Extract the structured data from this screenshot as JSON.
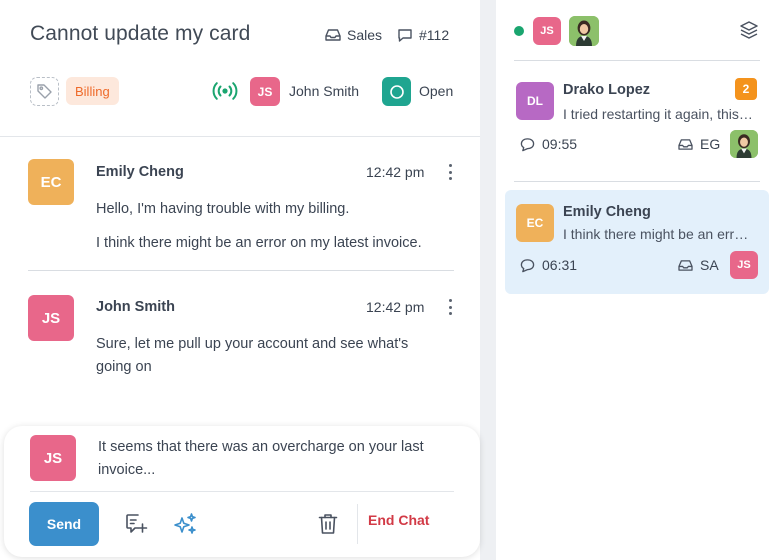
{
  "ticket": {
    "title": "Cannot update my card",
    "department": "Sales",
    "id": "#112",
    "tags": [
      "Billing"
    ],
    "assignee": {
      "initials": "JS",
      "name": "John Smith"
    },
    "status": "Open"
  },
  "messages": [
    {
      "initials": "EC",
      "author": "Emily Cheng",
      "time": "12:42 pm",
      "lines": [
        "Hello, I'm having trouble with my billing.",
        "I think there might be an error on my latest invoice."
      ]
    },
    {
      "initials": "JS",
      "author": "John Smith",
      "time": "12:42 pm",
      "lines": [
        "Sure, let me pull up your account and see what's",
        "going on"
      ]
    }
  ],
  "composer": {
    "initials": "JS",
    "draft_line1": "It seems that there was an overcharge on your last",
    "draft_line2": "invoice...",
    "send_label": "Send",
    "end_chat_label": "End Chat"
  },
  "sidebar": {
    "top_avatar_initials": "JS",
    "conversations": [
      {
        "initials": "DL",
        "name": "Drako Lopez",
        "preview": "I tried restarting it again, this time with the new settings",
        "unread": "2",
        "time": "09:55",
        "dept": "EG",
        "active": false
      },
      {
        "initials": "EC",
        "name": "Emily Cheng",
        "preview": "I think there might be an error on my latest invoice.",
        "time": "06:31",
        "dept": "SA",
        "agent_initials": "JS",
        "active": true
      }
    ]
  },
  "colors": {
    "accent_blue": "#3b8fcc",
    "end_chat_red": "#d23a46",
    "billing_tag_bg": "#fde8dc",
    "billing_tag_fg": "#ee6a2a",
    "status_open": "#1fa590",
    "online": "#1aa56f",
    "active_conversation_bg": "#e3f0fb"
  },
  "icons": {
    "department": "inbox-icon",
    "ticket_id": "chat-bubble-icon",
    "tag": "tag-icon",
    "live": "broadcast-signal-icon",
    "status": "circle-icon",
    "add_note": "message-plus-icon",
    "ai_assist": "sparkles-icon",
    "delete": "trash-icon",
    "layers": "layers-icon"
  }
}
